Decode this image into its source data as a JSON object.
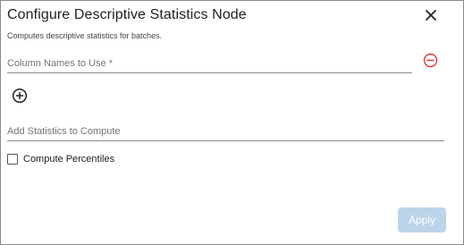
{
  "dialog": {
    "title": "Configure Descriptive Statistics Node",
    "subtitle": "Computes descriptive statistics for batches."
  },
  "fields": {
    "column_names": {
      "placeholder": "Column Names to Use *",
      "value": ""
    },
    "statistics": {
      "placeholder": "Add Statistics to Compute",
      "value": ""
    }
  },
  "checkbox": {
    "label": "Compute Percentiles",
    "checked": false
  },
  "buttons": {
    "apply_label": "Apply",
    "apply_disabled": true
  },
  "icons": {
    "close": "close-icon",
    "remove": "remove-circle-icon",
    "add": "add-circle-icon"
  },
  "colors": {
    "remove_icon": "#e53935",
    "apply_disabled_bg": "#bcd3ea",
    "text_primary": "#212121"
  }
}
